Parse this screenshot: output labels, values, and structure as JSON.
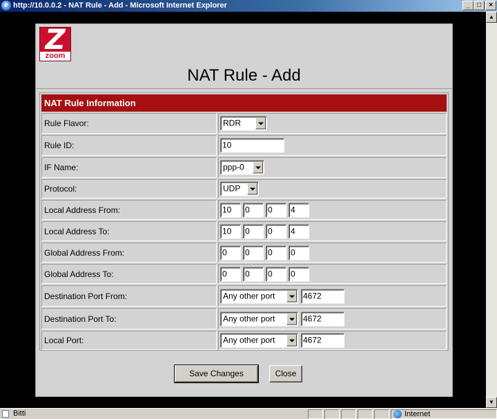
{
  "window": {
    "title": "http://10.0.0.2 - NAT Rule - Add - Microsoft Internet Explorer",
    "minimize_glyph": "_",
    "maximize_glyph": "□",
    "close_glyph": "×"
  },
  "logo": {
    "glyph": "Z",
    "text": "zoom",
    "color": "#c8102e"
  },
  "page": {
    "title": "NAT Rule - Add",
    "section_header": "NAT Rule Information",
    "header_color": "#a50f0f"
  },
  "form": {
    "rule_flavor": {
      "label": "Rule Flavor:",
      "value": "RDR"
    },
    "rule_id": {
      "label": "Rule ID:",
      "value": "10"
    },
    "if_name": {
      "label": "IF Name:",
      "value": "ppp-0"
    },
    "protocol": {
      "label": "Protocol:",
      "value": "UDP"
    },
    "local_address_from": {
      "label": "Local Address From:",
      "octets": [
        "10",
        "0",
        "0",
        "4"
      ]
    },
    "local_address_to": {
      "label": "Local Address To:",
      "octets": [
        "10",
        "0",
        "0",
        "4"
      ]
    },
    "global_address_from": {
      "label": "Global Address From:",
      "octets": [
        "0",
        "0",
        "0",
        "0"
      ]
    },
    "global_address_to": {
      "label": "Global Address To:",
      "octets": [
        "0",
        "0",
        "0",
        "0"
      ]
    },
    "destination_port_from": {
      "label": "Destination Port From:",
      "select": "Any other port",
      "port": "4672"
    },
    "destination_port_to": {
      "label": "Destination Port To:",
      "select": "Any other port",
      "port": "4672"
    },
    "local_port": {
      "label": "Local Port:",
      "select": "Any other port",
      "port": "4672"
    }
  },
  "buttons": {
    "save": "Save Changes",
    "close": "Close"
  },
  "statusbar": {
    "text": "Bitti",
    "zone": "Internet"
  },
  "icons": {
    "app": "internet-explorer-icon",
    "status_doc": "page-done-icon",
    "status_zone": "internet-zone-globe-icon"
  }
}
